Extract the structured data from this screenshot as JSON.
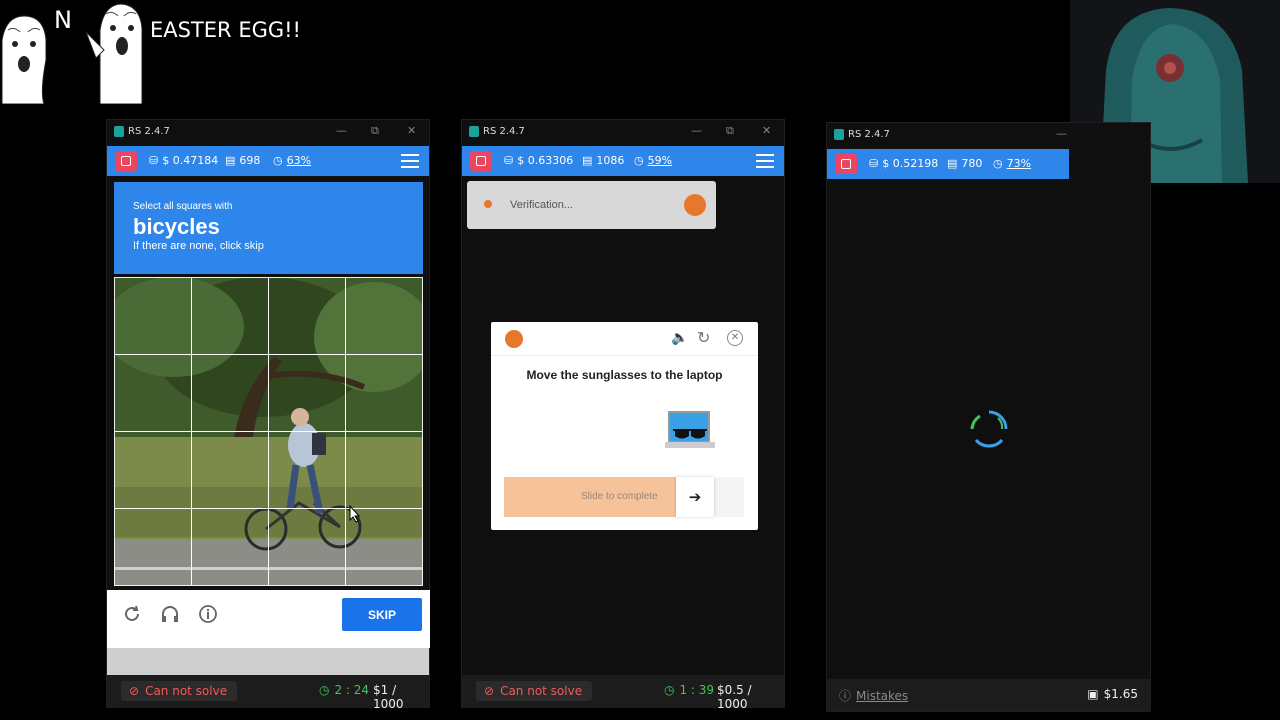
{
  "overlay": {
    "n_letter": "N",
    "caption": "EASTER EGG!!"
  },
  "colors": {
    "app_blue": "#2f86ea",
    "stop_red": "#ec4560",
    "error_red": "#f15a5a",
    "timer_green": "#44c35a",
    "captcha_orange": "#e8772e"
  },
  "windows": [
    {
      "title": "RS 2.4.7",
      "balance": "$ 0.47184",
      "count": "698",
      "percent": "63%",
      "captcha": {
        "instruction": "Select all squares with",
        "target": "bicycles",
        "hint": "If there are none, click skip",
        "skip_label": "SKIP"
      },
      "footer": {
        "status": "Can not solve",
        "timer": "2 : 24",
        "earnings": "$1 / 1000"
      }
    },
    {
      "title": "RS 2.4.7",
      "balance": "$ 0.63306",
      "count": "1086",
      "percent": "59%",
      "verification": "Verification...",
      "puzzle": {
        "prompt": "Move the sunglasses to the laptop",
        "slider_label": "Slide to complete"
      },
      "footer": {
        "status": "Can not solve",
        "timer": "1 : 39",
        "earnings": "$0.5 / 1000"
      }
    },
    {
      "title": "RS 2.4.7",
      "balance": "$ 0.52198",
      "count": "780",
      "percent": "73%",
      "footer": {
        "mistakes": "Mistakes",
        "wallet": "$1.65"
      }
    }
  ]
}
